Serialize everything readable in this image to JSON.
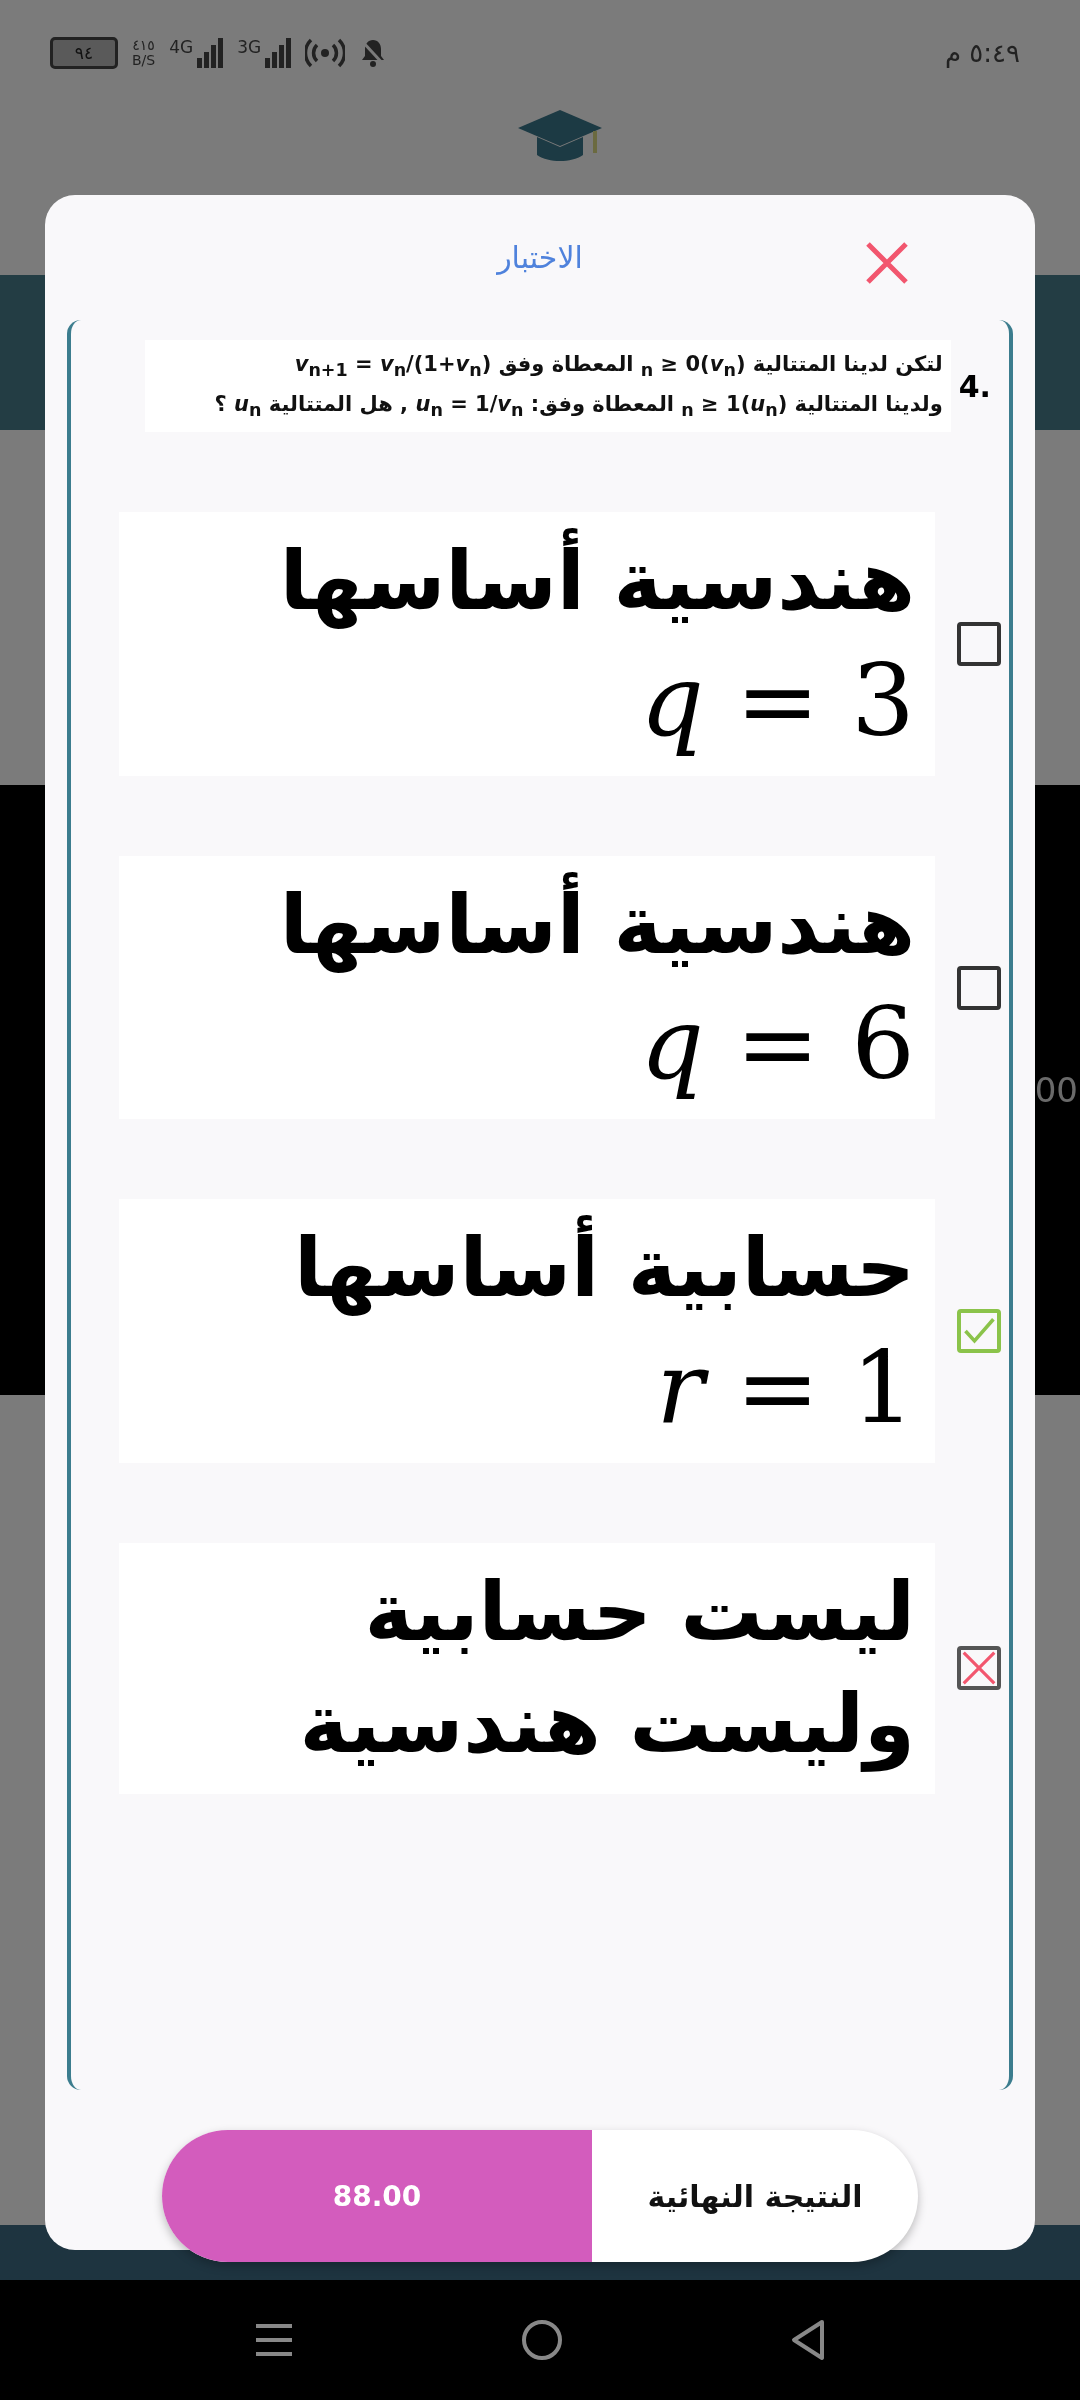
{
  "status_bar": {
    "time": "٥:٤٩ م",
    "battery": "٩٤",
    "speed": "٤١٥",
    "speed_unit": "B/S",
    "network_1": "4G",
    "network_2": "3G"
  },
  "background": {
    "side_text": "00"
  },
  "dialog": {
    "title": "الاختبار",
    "question": {
      "number": "4.",
      "lines": [
        "لتكن لدينا المتتالية (*v*$_{n}$)$_{n}$ ≥ 0 المعطاة وفق *v*$_{n+1}$ = *v*$_{n}$/(1+*v*$_{n}$)",
        "ولدينا المتتالية (*u*$_{n}$)$_{n}$ ≥ 1 المعطاة وفق: *u*$_{n}$ = 1/*v*$_{n}$ , هل المتتالية *u*$_{n}$ ؟"
      ]
    },
    "options": [
      {
        "checked": false,
        "lines": [
          {
            "kind": "text",
            "text": "هندسية أساسها"
          },
          {
            "kind": "math",
            "text": "*q* = 3"
          }
        ]
      },
      {
        "checked": false,
        "lines": [
          {
            "kind": "text",
            "text": "هندسية أساسها"
          },
          {
            "kind": "math",
            "text": "*q* = 6"
          }
        ]
      },
      {
        "checked": true,
        "correct": true,
        "lines": [
          {
            "kind": "text",
            "text": "حسابية أساسها"
          },
          {
            "kind": "math",
            "text": "*r* = 1"
          }
        ]
      },
      {
        "checked": true,
        "correct": false,
        "lines": [
          {
            "kind": "text",
            "text": "ليست حسابية"
          },
          {
            "kind": "text",
            "text": "وليست هندسية"
          }
        ]
      }
    ],
    "result": {
      "label": "النتيجة النهائية",
      "score": "88.00"
    }
  }
}
